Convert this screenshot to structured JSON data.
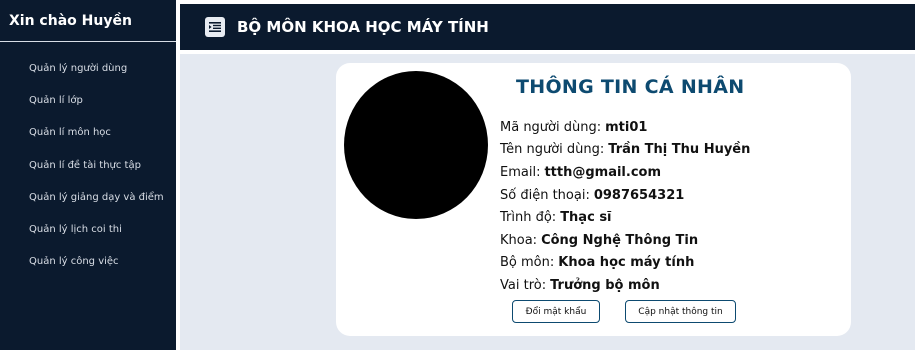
{
  "sidebar": {
    "greeting": "Xin chào Huyền",
    "items": [
      {
        "label": "Quản lý người dùng"
      },
      {
        "label": "Quản lí lớp"
      },
      {
        "label": "Quản lí môn học"
      },
      {
        "label": "Quản lí đề tài thực tập"
      },
      {
        "label": "Quản lý giảng dạy và điểm"
      },
      {
        "label": "Quản lý lịch coi thi"
      },
      {
        "label": "Quản lý công việc"
      }
    ]
  },
  "header": {
    "icon": "menu-toggle-icon",
    "title": "BỘ MÔN KHOA HỌC MÁY TÍNH"
  },
  "profile": {
    "title": "THÔNG TIN CÁ NHÂN",
    "fields": [
      {
        "label": "Mã người dùng:",
        "value": "mti01"
      },
      {
        "label": "Tên người dùng:",
        "value": "Trần Thị Thu Huyền"
      },
      {
        "label": "Email:",
        "value": "ttth@gmail.com"
      },
      {
        "label": "Số điện thoại:",
        "value": "0987654321"
      },
      {
        "label": "Trình độ:",
        "value": "Thạc sĩ"
      },
      {
        "label": "Khoa:",
        "value": "Công Nghệ Thông Tin"
      },
      {
        "label": "Bộ môn:",
        "value": "Khoa học máy tính"
      },
      {
        "label": "Vai trò:",
        "value": "Trưởng bộ môn"
      }
    ],
    "buttons": {
      "change_password": "Đổi mật khẩu",
      "update_info": "Cập nhật thông tin"
    }
  },
  "colors": {
    "navy": "#0b1a2e",
    "accent": "#0d4a70",
    "background": "#e4e9f1"
  }
}
